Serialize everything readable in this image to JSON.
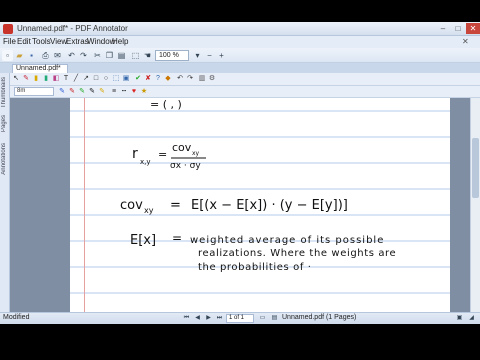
{
  "window": {
    "title": "Unnamed.pdf* - PDF Annotator",
    "controls": {
      "minimize": "–",
      "maximize": "□",
      "close": "✕"
    }
  },
  "menu": {
    "items": [
      "File",
      "Edit",
      "Tools",
      "View",
      "Extras",
      "Window",
      "Help"
    ],
    "close_doc": "✕"
  },
  "toolbar": {
    "zoom_value": "100 %",
    "icons": [
      "new-file-icon",
      "open-folder-icon",
      "save-icon",
      "print-icon",
      "email-icon",
      "undo-icon",
      "redo-icon",
      "cut-icon",
      "copy-icon",
      "paste-icon",
      "select-icon",
      "hand-icon",
      "zoom-out-icon",
      "zoom-in-icon",
      "page-layout-icon",
      "view-icon"
    ]
  },
  "tab": {
    "label": "Unnamed.pdf*"
  },
  "annotation_tools": {
    "icons": [
      "select-tool-icon",
      "pen-tool-icon",
      "highlighter-tool-icon",
      "marker-tool-icon",
      "eraser-tool-icon",
      "text-tool-icon",
      "line-tool-icon",
      "arrow-tool-icon",
      "rectangle-tool-icon",
      "ellipse-tool-icon",
      "stamp-tool-icon",
      "image-tool-icon",
      "check-tool-icon",
      "cross-tool-icon",
      "question-tool-icon",
      "color-tool-icon",
      "undo-tool-icon",
      "redo-tool-icon",
      "trash-tool-icon",
      "settings-tool-icon"
    ],
    "size_field": "8m",
    "style_icons": [
      "pen-blue-icon",
      "pen-red-icon",
      "pen-green-icon",
      "pen-black-icon",
      "pen-yellow-icon",
      "line-width-icon",
      "dash-icon",
      "heart-icon",
      "star-icon"
    ]
  },
  "sidebar": {
    "tabs": [
      "Thumbnails",
      "Pages",
      "Annotations"
    ]
  },
  "page_content": {
    "formula_partial": "= (  ,  )",
    "r_label": "r",
    "r_sub": "x,y",
    "r_equals": "=",
    "r_numerator": "cov",
    "r_numerator_sub": "xy",
    "r_denominator": "σx · σy",
    "cov_label": "cov",
    "cov_sub": "xy",
    "cov_equals": "=",
    "cov_expr": "E[(x − E[x]) · (y − E[y])]",
    "ex_label": "E[x]",
    "ex_equals": "=",
    "ex_line1": "weighted average of its possible",
    "ex_line2": "realizations. Where the weights are",
    "ex_line3": "the probabilities of ·"
  },
  "statusbar": {
    "left": "Modified",
    "page_value": "1",
    "page_of": "of 1",
    "doc_info": "Unnamed.pdf (1 Pages)"
  },
  "colors": {
    "chrome": "#d9e4f2",
    "page_background": "#7f8ea2",
    "ruled_line": "#9ab7e0",
    "margin_line": "#e6a0a0",
    "ink": "#111111"
  }
}
